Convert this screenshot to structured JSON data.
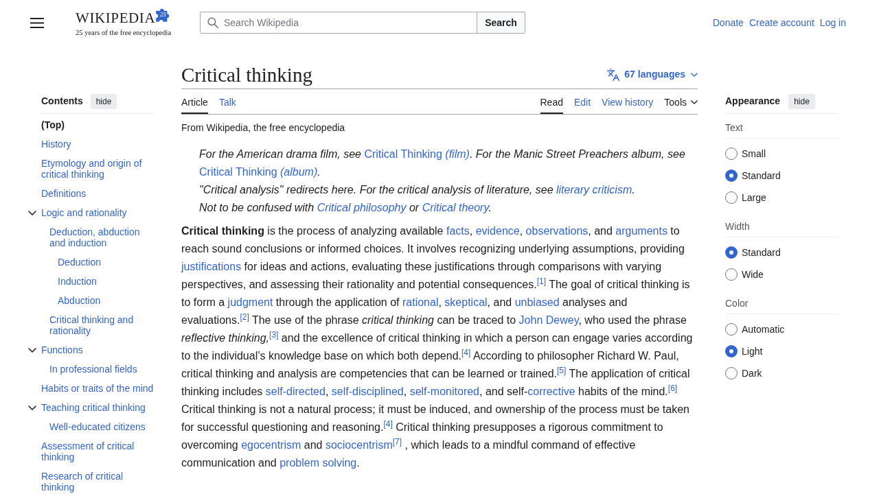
{
  "logo": {
    "wordmark": "WIKIPEDIA",
    "badge": "25",
    "tagline": "25 years of the free encyclopedia"
  },
  "search": {
    "placeholder": "Search Wikipedia",
    "button": "Search"
  },
  "user_links": [
    "Donate",
    "Create account",
    "Log in"
  ],
  "toc": {
    "title": "Contents",
    "hide_button": "hide",
    "items": [
      {
        "label": "(Top)",
        "selected": true
      },
      {
        "label": "History",
        "selected": false
      },
      {
        "label": "Etymology and origin of critical thinking",
        "selected": false
      },
      {
        "label": "Definitions",
        "selected": false
      },
      {
        "label": "Logic and rationality",
        "selected": false,
        "expanded": true,
        "children": [
          {
            "label": "Deduction, abduction and induction",
            "selected": false,
            "children": [
              {
                "label": "Deduction",
                "selected": false
              },
              {
                "label": "Induction",
                "selected": false
              },
              {
                "label": "Abduction",
                "selected": false
              }
            ]
          },
          {
            "label": "Critical thinking and rationality",
            "selected": false
          }
        ]
      },
      {
        "label": "Functions",
        "selected": false,
        "expanded": true,
        "children": [
          {
            "label": "In professional fields",
            "selected": false
          }
        ]
      },
      {
        "label": "Habits or traits of the mind",
        "selected": false
      },
      {
        "label": "Teaching critical thinking",
        "selected": false,
        "expanded": true,
        "children": [
          {
            "label": "Well-educated citizens",
            "selected": false
          }
        ]
      },
      {
        "label": "Assessment of critical thinking",
        "selected": false
      },
      {
        "label": "Research of critical thinking",
        "selected": false
      }
    ]
  },
  "article": {
    "title": "Critical thinking",
    "languages": "67 languages",
    "tabs_left": [
      {
        "label": "Article",
        "selected": true,
        "kind": "tab"
      },
      {
        "label": "Talk",
        "selected": false,
        "kind": "tab"
      }
    ],
    "tabs_right": [
      {
        "label": "Read",
        "selected": true,
        "kind": "tab"
      },
      {
        "label": "Edit",
        "selected": false,
        "kind": "tab"
      },
      {
        "label": "View history",
        "selected": false,
        "kind": "tab"
      },
      {
        "label": "Tools",
        "selected": false,
        "kind": "menu"
      }
    ],
    "tagline": "From Wikipedia, the free encyclopedia",
    "hatnotes": [
      {
        "segments": [
          {
            "kind": "plain",
            "text": "For the American drama film, see "
          },
          {
            "kind": "link",
            "text": "Critical Thinking *(film)*",
            "upright": true
          },
          {
            "kind": "plain",
            "text": ". For the Manic Street Preachers album, see "
          },
          {
            "kind": "link",
            "text": "Critical Thinking *(album)*",
            "upright": true
          },
          {
            "kind": "plain",
            "text": "."
          }
        ]
      },
      {
        "segments": [
          {
            "kind": "plain",
            "text": "\"Critical analysis\" redirects here. For the critical analysis of literature, see "
          },
          {
            "kind": "link",
            "text": "literary criticism",
            "upright": false
          },
          {
            "kind": "plain",
            "text": "."
          }
        ]
      },
      {
        "segments": [
          {
            "kind": "plain",
            "text": "Not to be confused with "
          },
          {
            "kind": "link",
            "text": "Critical philosophy",
            "upright": false
          },
          {
            "kind": "plain",
            "text": " or "
          },
          {
            "kind": "link",
            "text": "Critical theory",
            "upright": false
          },
          {
            "kind": "plain",
            "text": "."
          }
        ]
      }
    ],
    "paragraph": [
      {
        "kind": "bold",
        "text": "Critical thinking"
      },
      {
        "kind": "plain",
        "text": " is the process of analyzing available "
      },
      {
        "kind": "link",
        "text": "facts"
      },
      {
        "kind": "plain",
        "text": ", "
      },
      {
        "kind": "link",
        "text": "evidence"
      },
      {
        "kind": "plain",
        "text": ", "
      },
      {
        "kind": "link",
        "text": "observations"
      },
      {
        "kind": "plain",
        "text": ", and "
      },
      {
        "kind": "link",
        "text": "arguments"
      },
      {
        "kind": "plain",
        "text": " to reach sound conclusions or informed choices. It involves recognizing underlying assumptions, providing "
      },
      {
        "kind": "link",
        "text": "justifications"
      },
      {
        "kind": "plain",
        "text": " for ideas and actions, evaluating these justifications through comparisons with varying perspectives, and assessing their rationality and potential consequences."
      },
      {
        "kind": "ref",
        "text": "[1]"
      },
      {
        "kind": "plain",
        "text": " The goal of critical thinking is to form a "
      },
      {
        "kind": "link",
        "text": "judgment"
      },
      {
        "kind": "plain",
        "text": " through the application of "
      },
      {
        "kind": "link",
        "text": "rational"
      },
      {
        "kind": "plain",
        "text": ", "
      },
      {
        "kind": "link",
        "text": "skeptical"
      },
      {
        "kind": "plain",
        "text": ", and "
      },
      {
        "kind": "link",
        "text": "unbiased"
      },
      {
        "kind": "plain",
        "text": " analyses and evaluations."
      },
      {
        "kind": "ref",
        "text": "[2]"
      },
      {
        "kind": "plain",
        "text": " The use of the phrase "
      },
      {
        "kind": "italic",
        "text": "critical thinking"
      },
      {
        "kind": "plain",
        "text": " can be traced to "
      },
      {
        "kind": "link",
        "text": "John Dewey"
      },
      {
        "kind": "plain",
        "text": ", who used the phrase "
      },
      {
        "kind": "italic",
        "text": "reflective thinking,"
      },
      {
        "kind": "ref",
        "text": "[3]"
      },
      {
        "kind": "plain",
        "text": " and the excellence of critical thinking in which a person can engage varies according to the individual’s knowledge base on which both depend."
      },
      {
        "kind": "ref",
        "text": "[4]"
      },
      {
        "kind": "plain",
        "text": " According to philosopher Richard W. Paul, critical thinking and analysis are competencies that can be learned or trained."
      },
      {
        "kind": "ref",
        "text": "[5]"
      },
      {
        "kind": "plain",
        "text": " The application of critical thinking includes "
      },
      {
        "kind": "link",
        "text": "self-directed"
      },
      {
        "kind": "plain",
        "text": ", "
      },
      {
        "kind": "link",
        "text": "self-disciplined"
      },
      {
        "kind": "plain",
        "text": ", "
      },
      {
        "kind": "link",
        "text": "self-monitored"
      },
      {
        "kind": "plain",
        "text": ", and self-"
      },
      {
        "kind": "link",
        "text": "corrective"
      },
      {
        "kind": "plain",
        "text": " habits of the mind."
      },
      {
        "kind": "ref",
        "text": "[6]"
      },
      {
        "kind": "plain",
        "text": " Critical thinking is not a natural process; it must be induced, and ownership of the process must be taken for successful questioning and reasoning."
      },
      {
        "kind": "ref",
        "text": "[4]"
      },
      {
        "kind": "plain",
        "text": " Critical thinking presupposes a rigorous commitment to overcoming "
      },
      {
        "kind": "link",
        "text": "egocentrism"
      },
      {
        "kind": "plain",
        "text": " and "
      },
      {
        "kind": "link",
        "text": "sociocentrism"
      },
      {
        "kind": "ref",
        "text": "[7]"
      },
      {
        "kind": "plain",
        "text": " , which leads to a mindful command of effective communication and "
      },
      {
        "kind": "link",
        "text": "problem solving"
      },
      {
        "kind": "plain",
        "text": "."
      }
    ]
  },
  "appearance": {
    "title": "Appearance",
    "hide_button": "hide",
    "groups": [
      {
        "label": "Text",
        "options": [
          {
            "label": "Small",
            "selected": false
          },
          {
            "label": "Standard",
            "selected": true
          },
          {
            "label": "Large",
            "selected": false
          }
        ]
      },
      {
        "label": "Width",
        "options": [
          {
            "label": "Standard",
            "selected": true
          },
          {
            "label": "Wide",
            "selected": false
          }
        ]
      },
      {
        "label": "Color",
        "options": [
          {
            "label": "Automatic",
            "selected": false
          },
          {
            "label": "Light",
            "selected": true
          },
          {
            "label": "Dark",
            "selected": false
          }
        ]
      }
    ]
  }
}
